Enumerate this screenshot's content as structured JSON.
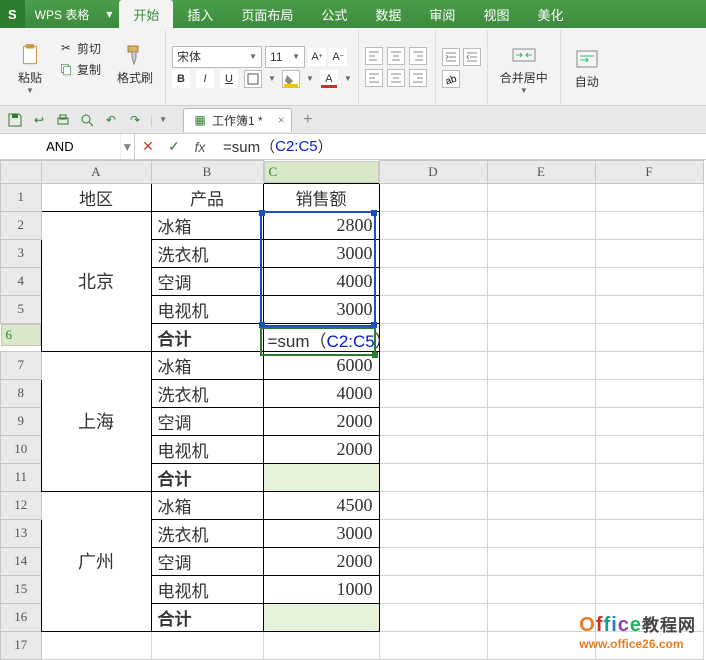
{
  "app": {
    "badge": "S",
    "name": "WPS 表格"
  },
  "menu": {
    "tabs": [
      "开始",
      "插入",
      "页面布局",
      "公式",
      "数据",
      "审阅",
      "视图",
      "美化"
    ],
    "active": 0
  },
  "ribbon": {
    "paste": "粘贴",
    "cut": "剪切",
    "copy": "复制",
    "format_painter": "格式刷",
    "font_name": "宋体",
    "font_size": "11",
    "merge_center": "合并居中",
    "autowrap": "自动"
  },
  "doc": {
    "tab_label": "工作簿1 *"
  },
  "formula_bar": {
    "name_box": "AND",
    "formula_prefix": "=sum（",
    "formula_ref": "C2:C5",
    "formula_suffix": "）"
  },
  "columns": [
    "A",
    "B",
    "C",
    "D",
    "E",
    "F"
  ],
  "rows": [
    "1",
    "2",
    "3",
    "4",
    "5",
    "6",
    "7",
    "8",
    "9",
    "10",
    "11",
    "12",
    "13",
    "14",
    "15",
    "16",
    "17"
  ],
  "table": {
    "headers": {
      "region": "地区",
      "product": "产品",
      "sales": "销售额"
    },
    "groups": [
      {
        "region": "北京",
        "items": [
          {
            "product": "冰箱",
            "sales": "2800"
          },
          {
            "product": "洗衣机",
            "sales": "3000"
          },
          {
            "product": "空调",
            "sales": "4000"
          },
          {
            "product": "电视机",
            "sales": "3000"
          }
        ],
        "total_label": "合计",
        "total_formula": {
          "prefix": "=sum（",
          "ref": "C2:C5",
          "suffix": "）"
        }
      },
      {
        "region": "上海",
        "items": [
          {
            "product": "冰箱",
            "sales": "6000"
          },
          {
            "product": "洗衣机",
            "sales": "4000"
          },
          {
            "product": "空调",
            "sales": "2000"
          },
          {
            "product": "电视机",
            "sales": "2000"
          }
        ],
        "total_label": "合计",
        "total_value": ""
      },
      {
        "region": "广州",
        "items": [
          {
            "product": "冰箱",
            "sales": "4500"
          },
          {
            "product": "洗衣机",
            "sales": "3000"
          },
          {
            "product": "空调",
            "sales": "2000"
          },
          {
            "product": "电视机",
            "sales": "1000"
          }
        ],
        "total_label": "合计",
        "total_value": ""
      }
    ]
  },
  "watermark": {
    "brand_cn": "教程网",
    "url": "www.office26.com"
  }
}
